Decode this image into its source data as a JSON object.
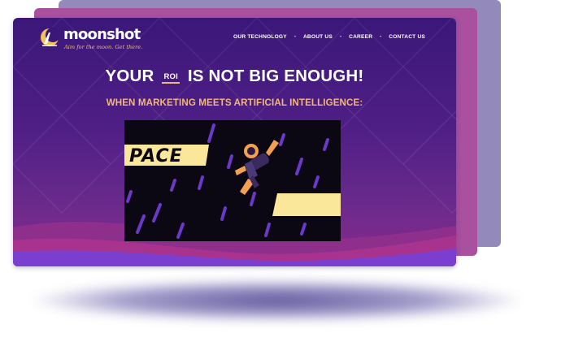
{
  "brand": {
    "name": "moonshot",
    "tagline": "Aim for the moon. Get there."
  },
  "nav": {
    "items": [
      {
        "label": "OUR TECHNOLOGY"
      },
      {
        "label": "ABOUT US"
      },
      {
        "label": "CAREER"
      },
      {
        "label": "CONTACT US"
      }
    ]
  },
  "hero": {
    "headline_start": "YOUR",
    "headline_tag": "ROI",
    "headline_end": "IS NOT BIG ENOUGH!",
    "subheadline": "WHEN MARKETING MEETS ARTIFICIAL INTELLIGENCE:"
  },
  "video": {
    "banner_text": "PACE"
  },
  "colors": {
    "site_bg_top": "#3b1779",
    "accent_orange": "#f3b779",
    "accent_gold": "#f1c15e",
    "banner_yellow": "#fbe79a",
    "back_card_lilac": "#9389ba",
    "back_card_magenta": "#a9509e"
  },
  "icons": {
    "logo": "moon-rocket-logo-icon",
    "astronaut": "flying-astronaut-icon"
  }
}
